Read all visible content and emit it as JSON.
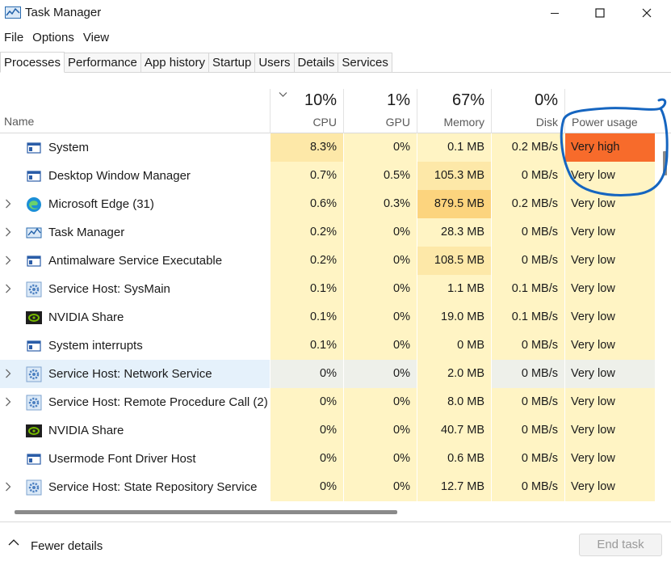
{
  "window": {
    "title": "Task Manager"
  },
  "menu": [
    "File",
    "Options",
    "View"
  ],
  "tabs": [
    "Processes",
    "Performance",
    "App history",
    "Startup",
    "Users",
    "Details",
    "Services"
  ],
  "columns": {
    "name": "Name",
    "cpu": {
      "percent": "10%",
      "label": "CPU"
    },
    "gpu": {
      "percent": "1%",
      "label": "GPU"
    },
    "memory": {
      "percent": "67%",
      "label": "Memory"
    },
    "disk": {
      "percent": "0%",
      "label": "Disk"
    },
    "power": {
      "label": "Power usage"
    }
  },
  "rows": [
    {
      "name": "System",
      "icon": "system-window-icon",
      "expandable": false,
      "cpu": "8.3%",
      "gpu": "0%",
      "memory": "0.1 MB",
      "disk": "0.2 MB/s",
      "power": "Very high"
    },
    {
      "name": "Desktop Window Manager",
      "icon": "system-window-icon",
      "expandable": false,
      "cpu": "0.7%",
      "gpu": "0.5%",
      "memory": "105.3 MB",
      "disk": "0 MB/s",
      "power": "Very low"
    },
    {
      "name": "Microsoft Edge (31)",
      "icon": "edge-icon",
      "expandable": true,
      "cpu": "0.6%",
      "gpu": "0.3%",
      "memory": "879.5 MB",
      "disk": "0.2 MB/s",
      "power": "Very low"
    },
    {
      "name": "Task Manager",
      "icon": "task-manager-icon",
      "expandable": true,
      "cpu": "0.2%",
      "gpu": "0%",
      "memory": "28.3 MB",
      "disk": "0 MB/s",
      "power": "Very low"
    },
    {
      "name": "Antimalware Service Executable",
      "icon": "system-window-icon",
      "expandable": true,
      "cpu": "0.2%",
      "gpu": "0%",
      "memory": "108.5 MB",
      "disk": "0 MB/s",
      "power": "Very low"
    },
    {
      "name": "Service Host: SysMain",
      "icon": "gear-icon",
      "expandable": true,
      "cpu": "0.1%",
      "gpu": "0%",
      "memory": "1.1 MB",
      "disk": "0.1 MB/s",
      "power": "Very low"
    },
    {
      "name": "NVIDIA Share",
      "icon": "nvidia-icon",
      "expandable": false,
      "cpu": "0.1%",
      "gpu": "0%",
      "memory": "19.0 MB",
      "disk": "0.1 MB/s",
      "power": "Very low"
    },
    {
      "name": "System interrupts",
      "icon": "system-window-icon",
      "expandable": false,
      "cpu": "0.1%",
      "gpu": "0%",
      "memory": "0 MB",
      "disk": "0 MB/s",
      "power": "Very low"
    },
    {
      "name": "Service Host: Network Service",
      "icon": "gear-icon",
      "expandable": true,
      "cpu": "0%",
      "gpu": "0%",
      "memory": "2.0 MB",
      "disk": "0 MB/s",
      "power": "Very low"
    },
    {
      "name": "Service Host: Remote Procedure Call (2)",
      "icon": "gear-icon",
      "expandable": true,
      "cpu": "0%",
      "gpu": "0%",
      "memory": "8.0 MB",
      "disk": "0 MB/s",
      "power": "Very low"
    },
    {
      "name": "NVIDIA Share",
      "icon": "nvidia-icon",
      "expandable": false,
      "cpu": "0%",
      "gpu": "0%",
      "memory": "40.7 MB",
      "disk": "0 MB/s",
      "power": "Very low"
    },
    {
      "name": "Usermode Font Driver Host",
      "icon": "system-window-icon",
      "expandable": false,
      "cpu": "0%",
      "gpu": "0%",
      "memory": "0.6 MB",
      "disk": "0 MB/s",
      "power": "Very low"
    },
    {
      "name": "Service Host: State Repository Service",
      "icon": "gear-icon",
      "expandable": true,
      "cpu": "0%",
      "gpu": "0%",
      "memory": "12.7 MB",
      "disk": "0 MB/s",
      "power": "Very low"
    }
  ],
  "footer": {
    "fewer_details": "Fewer details",
    "end_task": "End task"
  },
  "colors": {
    "heat_light": "#fff4c4",
    "heat_medium": "#fde8a8",
    "heat_strong": "#fcd47e",
    "power_very_high": "#f76b2b",
    "selected_row": "#e5f1fb",
    "annotation": "#1565c0"
  }
}
